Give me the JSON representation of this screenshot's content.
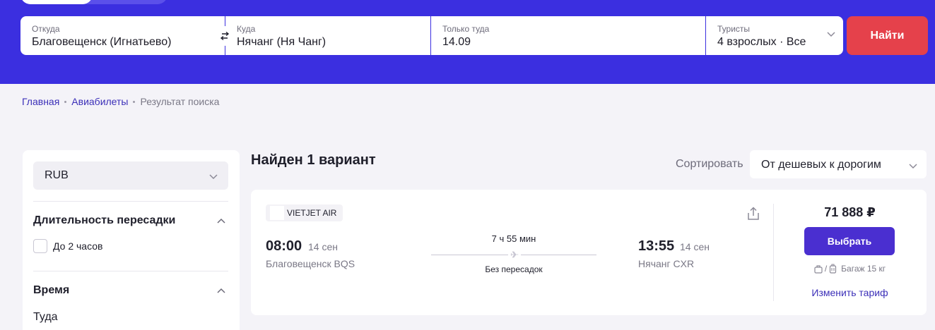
{
  "search": {
    "from": {
      "label": "Откуда",
      "value": "Благовещенск (Игнатьево)"
    },
    "to": {
      "label": "Куда",
      "value": "Нячанг (Ня Чанг)"
    },
    "date": {
      "label": "Только туда",
      "value": "14.09"
    },
    "tourists": {
      "label": "Туристы",
      "value": "4 взрослых · Все"
    },
    "find_button": "Найти"
  },
  "breadcrumbs": [
    {
      "label": "Главная"
    },
    {
      "label": "Авиабилеты"
    },
    {
      "label": "Результат поиска"
    }
  ],
  "filters": {
    "currency": "RUB",
    "transfer_section": {
      "title": "Длительность пересадки",
      "option": "До 2 часов"
    },
    "time_section": {
      "title": "Время",
      "sub_label": "Туда"
    }
  },
  "results": {
    "found_text": "Найден 1 вариант",
    "sort_label": "Сортировать",
    "sort_value": "От дешевых к дорогим"
  },
  "ticket": {
    "airline": "VIETJET AIR",
    "departure": {
      "time": "08:00",
      "date": "14 сен",
      "city": "Благовещенск BQS"
    },
    "arrival": {
      "time": "13:55",
      "date": "14 сен",
      "city": "Нячанг CXR"
    },
    "duration": "7 ч 55 мин",
    "stops": "Без пересадок",
    "price": "71 888 ₽",
    "select_button": "Выбрать",
    "baggage": "Багаж 15 кг",
    "change_fare": "Изменить тариф"
  },
  "colors": {
    "header_bg": "#3b2fe0",
    "find_button": "#e5414b",
    "select_button": "#4a2fd0",
    "link": "#3b2fb8"
  }
}
